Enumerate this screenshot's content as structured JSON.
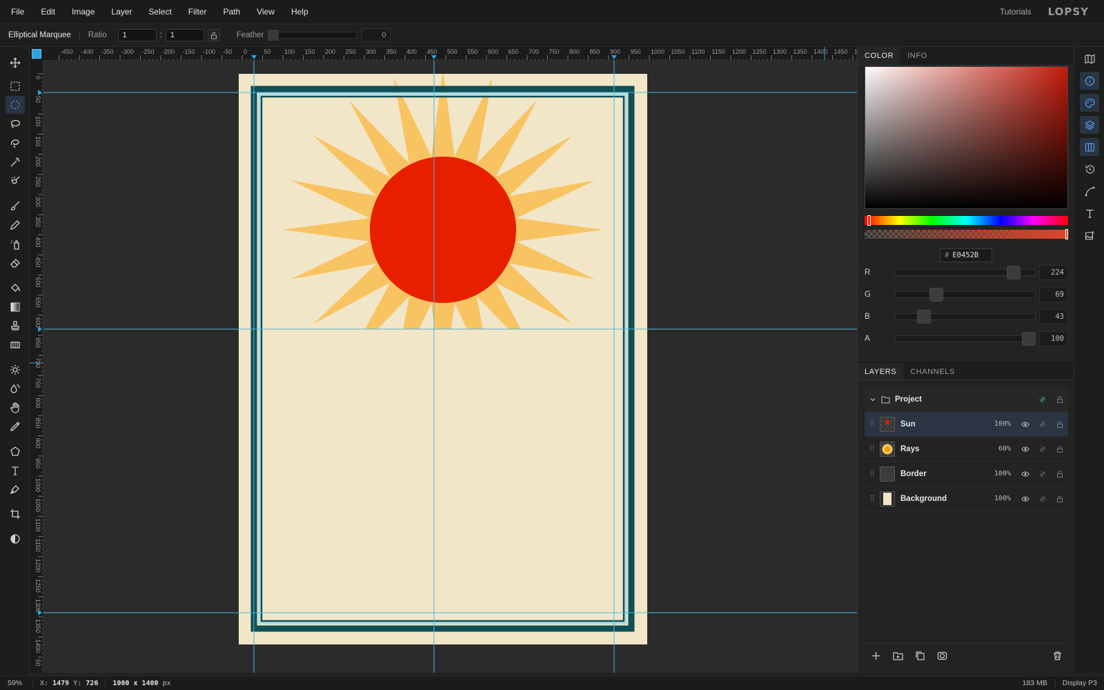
{
  "menu": [
    "File",
    "Edit",
    "Image",
    "Layer",
    "Select",
    "Filter",
    "Path",
    "View",
    "Help"
  ],
  "header": {
    "tutorials": "Tutorials",
    "logo": "LOPSY"
  },
  "options": {
    "tool_name": "Elliptical Marquee",
    "ratio_label": "Ratio",
    "ratio_w": "1",
    "ratio_separator": ":",
    "ratio_h": "1",
    "feather_label": "Feather",
    "feather_value": "0"
  },
  "rulers": {
    "top": [
      "-450",
      "-400",
      "-350",
      "-300",
      "-250",
      "-200",
      "-150",
      "-100",
      "-50",
      "0",
      "50",
      "100",
      "150",
      "200",
      "250",
      "300",
      "350",
      "400",
      "450",
      "500",
      "550",
      "600",
      "650",
      "700",
      "750",
      "800",
      "850",
      "900",
      "950",
      "1000",
      "1050",
      "1100",
      "1150",
      "1200",
      "1250",
      "1300",
      "1350",
      "1400",
      "1450",
      "1"
    ],
    "left": [
      "0",
      "50",
      "100",
      "150",
      "200",
      "250",
      "300",
      "350",
      "400",
      "450",
      "500",
      "550",
      "600",
      "650",
      "700",
      "750",
      "800",
      "850",
      "900",
      "950",
      "1000",
      "1050",
      "1100",
      "1150",
      "1200",
      "1250",
      "1300",
      "1350",
      "1400",
      "50"
    ]
  },
  "color_panel": {
    "tabs": [
      "COLOR",
      "INFO"
    ],
    "hex_prefix": "#",
    "hex": "E0452B",
    "channels": [
      {
        "label": "R",
        "value": "224",
        "level": 224,
        "max": 255
      },
      {
        "label": "G",
        "value": "69",
        "level": 69,
        "max": 255
      },
      {
        "label": "B",
        "value": "43",
        "level": 43,
        "max": 255
      },
      {
        "label": "A",
        "value": "100",
        "level": 100,
        "max": 100
      }
    ],
    "current_color": "#E0452B"
  },
  "layers_panel": {
    "tabs": [
      "LAYERS",
      "CHANNELS"
    ],
    "group": {
      "name": "Project"
    },
    "layers": [
      {
        "name": "Sun",
        "opacity": "100%",
        "selected": true
      },
      {
        "name": "Rays",
        "opacity": "60%",
        "selected": false
      },
      {
        "name": "Border",
        "opacity": "100%",
        "selected": false
      },
      {
        "name": "Background",
        "opacity": "100%",
        "selected": false
      }
    ]
  },
  "canvas": {
    "background_color": "#F2E6C8",
    "border_color": "#0F4F55",
    "border_inner_color": "#B9DDE0",
    "rays_color": "#F8C462",
    "sun_color": "#E81E00",
    "guide_color": "#4DB8DC"
  },
  "status": {
    "zoom": "59%",
    "x_label": "X:",
    "x": "1479",
    "y_label": "Y:",
    "y": "726",
    "doc_size": "1000 x 1400",
    "doc_unit": "px",
    "memory": "183 MB",
    "profile": "Display P3"
  }
}
